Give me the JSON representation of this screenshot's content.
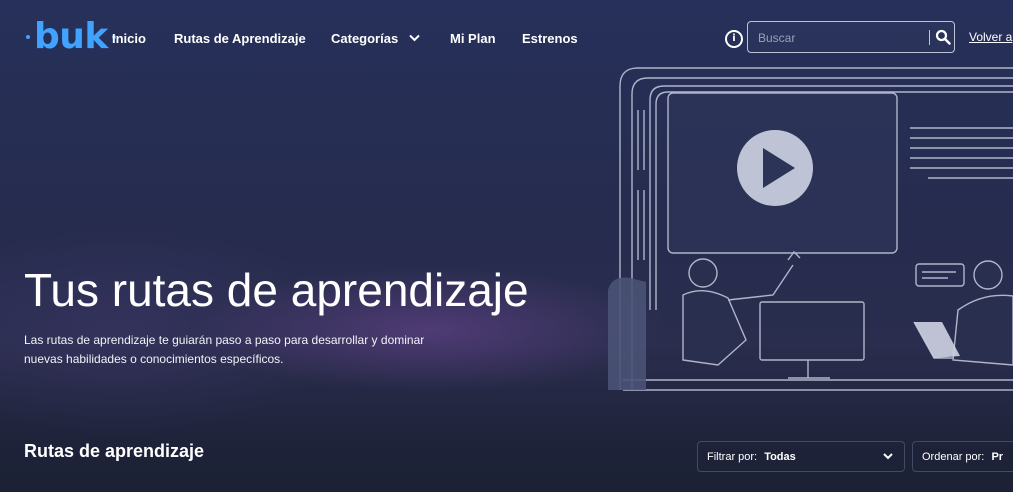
{
  "nav": {
    "logo_text": "buk",
    "links": [
      {
        "label": "Inicio"
      },
      {
        "label": "Rutas de Aprendizaje"
      },
      {
        "label": "Categorías"
      },
      {
        "label": "Mi Plan"
      },
      {
        "label": "Estrenos"
      }
    ],
    "search_placeholder": "Buscar",
    "back_link": "Volver a"
  },
  "hero": {
    "title": "Tus rutas de aprendizaje",
    "description": "Las rutas de aprendizaje te guiarán paso a paso para desarrollar y dominar nuevas habilidades o conocimientos específicos."
  },
  "section": {
    "title": "Rutas de aprendizaje",
    "filter_label": "Filtrar por:",
    "filter_value": "Todas",
    "sort_label": "Ordenar por:",
    "sort_value": "Pr"
  },
  "colors": {
    "brand": "#3fa3ff",
    "background": "#262c4e",
    "text": "#ffffff"
  }
}
